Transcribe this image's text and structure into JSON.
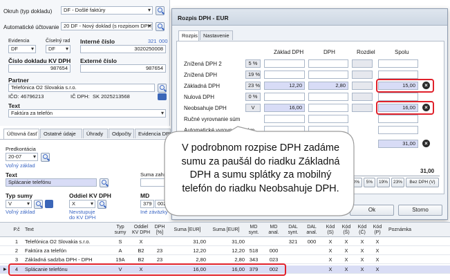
{
  "left_form": {
    "okruh_label": "Okruh (typ dokladu)",
    "okruh_value": "DF - Došlé faktúry",
    "auto_label": "Automatické účtovanie",
    "auto_value": "20 DF - Nový doklad (s rozpisom DPH)",
    "evidencia_label": "Evidencia",
    "evidencia_value": "DF",
    "ciselny_rad_label": "Číselný rad",
    "ciselny_rad_value": "DF",
    "interne_cislo_label": "Interné číslo",
    "interne_cislo_link": "321",
    "interne_cislo_link2": "000",
    "interne_cislo_value": "3020250008",
    "cislo_dokladu_label": "Číslo dokladu KV DPH",
    "cislo_dokladu_value": "987654",
    "externe_cislo_label": "Externé číslo",
    "externe_cislo_value": "987654",
    "partner_label": "Partner",
    "partner_value": "Telefónica O2 Slovakia s.r.o.",
    "ico_label": "IČO:",
    "ico_value": "46796213",
    "ic_dph_label": "IČ DPH:",
    "ic_dph_value": "SK 2025213568",
    "text_label": "Text",
    "text_value": "Faktúra za telefón"
  },
  "left_tabs": [
    "Účtovná časť",
    "Ostatné údaje",
    "Úhrady",
    "Odpočty",
    "Evidencia DPH"
  ],
  "accounting": {
    "predkontacia_label": "Predkontácia",
    "predkontacia_value": "20-07",
    "volny_zaklad": "Voľný základ",
    "text_label": "Text",
    "text_value": "Splácanie telefónu",
    "suma_label": "Suma zahr",
    "typ_sumy_label": "Typ sumy",
    "typ_sumy_value": "V",
    "volny_zaklad2": "Voľný základ",
    "oddiel_label": "Oddiel KV DPH",
    "oddiel_value": "X",
    "nevstupuje": "Nevstupuje",
    "do_kv_dph": "do KV DPH",
    "md_label": "MD",
    "md_value": "379",
    "md_value2": "002",
    "ine_zavazky": "Iné záväzky"
  },
  "dialog": {
    "title": "Rozpis DPH - EUR",
    "tabs": [
      "Rozpis",
      "Nastavenie"
    ],
    "col_headers": [
      "Základ DPH",
      "DPH",
      "Rozdiel",
      "Spolu"
    ],
    "rows": [
      {
        "label": "Znížená DPH 2",
        "rate": "5 %",
        "zaklad": "",
        "dph": "",
        "rozdiel": "",
        "spolu": ""
      },
      {
        "label": "Znížená DPH",
        "rate": "19 %",
        "zaklad": "",
        "dph": "",
        "rozdiel": "",
        "spolu": ""
      },
      {
        "label": "Základná DPH",
        "rate": "23 %",
        "zaklad": "12,20",
        "dph": "2,80",
        "rozdiel": "",
        "spolu": "15,00"
      },
      {
        "label": "Nulová DPH",
        "rate": "0 %",
        "zaklad": "",
        "dph": "",
        "rozdiel": "",
        "spolu": ""
      },
      {
        "label": "Neobsahuje DPH",
        "rate": "V",
        "zaklad": "16,00",
        "dph": "",
        "rozdiel": "",
        "spolu": "16,00"
      },
      {
        "label": "Ručné vyrovnanie súm",
        "rate": "",
        "zaklad": "",
        "dph": "",
        "rozdiel": "",
        "spolu": ""
      },
      {
        "label": "Automatické vyrovnanie súm",
        "rate": "",
        "zaklad": "",
        "dph": "",
        "rozdiel": "",
        "spolu": ""
      }
    ],
    "total_value": "31,00",
    "total_bottom": "31,00",
    "rate_buttons": [
      "0%",
      "5%",
      "19%",
      "23%",
      "Bez DPH (V)"
    ],
    "ok_label": "Ok",
    "storno_label": "Storno"
  },
  "callout_text": "V podrobnom rozpise DPH zadáme sumu za paušál do riadku Základná DPH a sumu splátky za mobilný telefón do riadku Neobsahuje DPH.",
  "grid": {
    "headers": [
      "P.č",
      "Text",
      "Typ sumy",
      "Oddiel KV DPH",
      "DPH [%]",
      "Suma [EUR]",
      "Suma [EUR]",
      "MD synt.",
      "MD anal.",
      "DAL synt.",
      "DAL anal.",
      "Kód (S)",
      "Kód (Š)",
      "Kód (Č)",
      "Kód (P)",
      "Poznámka"
    ],
    "rows": [
      {
        "pc": "1",
        "text": "Telefónica O2 Slovakia s.r.o.",
        "typ": "S",
        "oddiel": "X",
        "dph": "",
        "suma1": "31,00",
        "suma2": "31,00",
        "md_s": "",
        "md_a": "",
        "dal_s": "321",
        "dal_a": "000",
        "k1": "X",
        "k2": "X",
        "k3": "X",
        "k4": "X"
      },
      {
        "pc": "2",
        "text": "Faktúra za telefón",
        "typ": "A",
        "oddiel": "B2",
        "dph": "23",
        "suma1": "12,20",
        "suma2": "12,20",
        "md_s": "518",
        "md_a": "000",
        "dal_s": "",
        "dal_a": "",
        "k1": "X",
        "k2": "X",
        "k3": "X",
        "k4": "X"
      },
      {
        "pc": "3",
        "text": "Základná sadzba DPH - DPH",
        "typ": "19A",
        "oddiel": "B2",
        "dph": "23",
        "suma1": "2,80",
        "suma2": "2,80",
        "md_s": "343",
        "md_a": "023",
        "dal_s": "",
        "dal_a": "",
        "k1": "X",
        "k2": "X",
        "k3": "X",
        "k4": "X"
      },
      {
        "pc": "4",
        "text": "Splácanie telefónu",
        "typ": "V",
        "oddiel": "X",
        "dph": "",
        "suma1": "16,00",
        "suma2": "16,00",
        "md_s": "379",
        "md_a": "002",
        "dal_s": "",
        "dal_a": "",
        "k1": "X",
        "k2": "X",
        "k3": "X",
        "k4": "X"
      }
    ]
  }
}
